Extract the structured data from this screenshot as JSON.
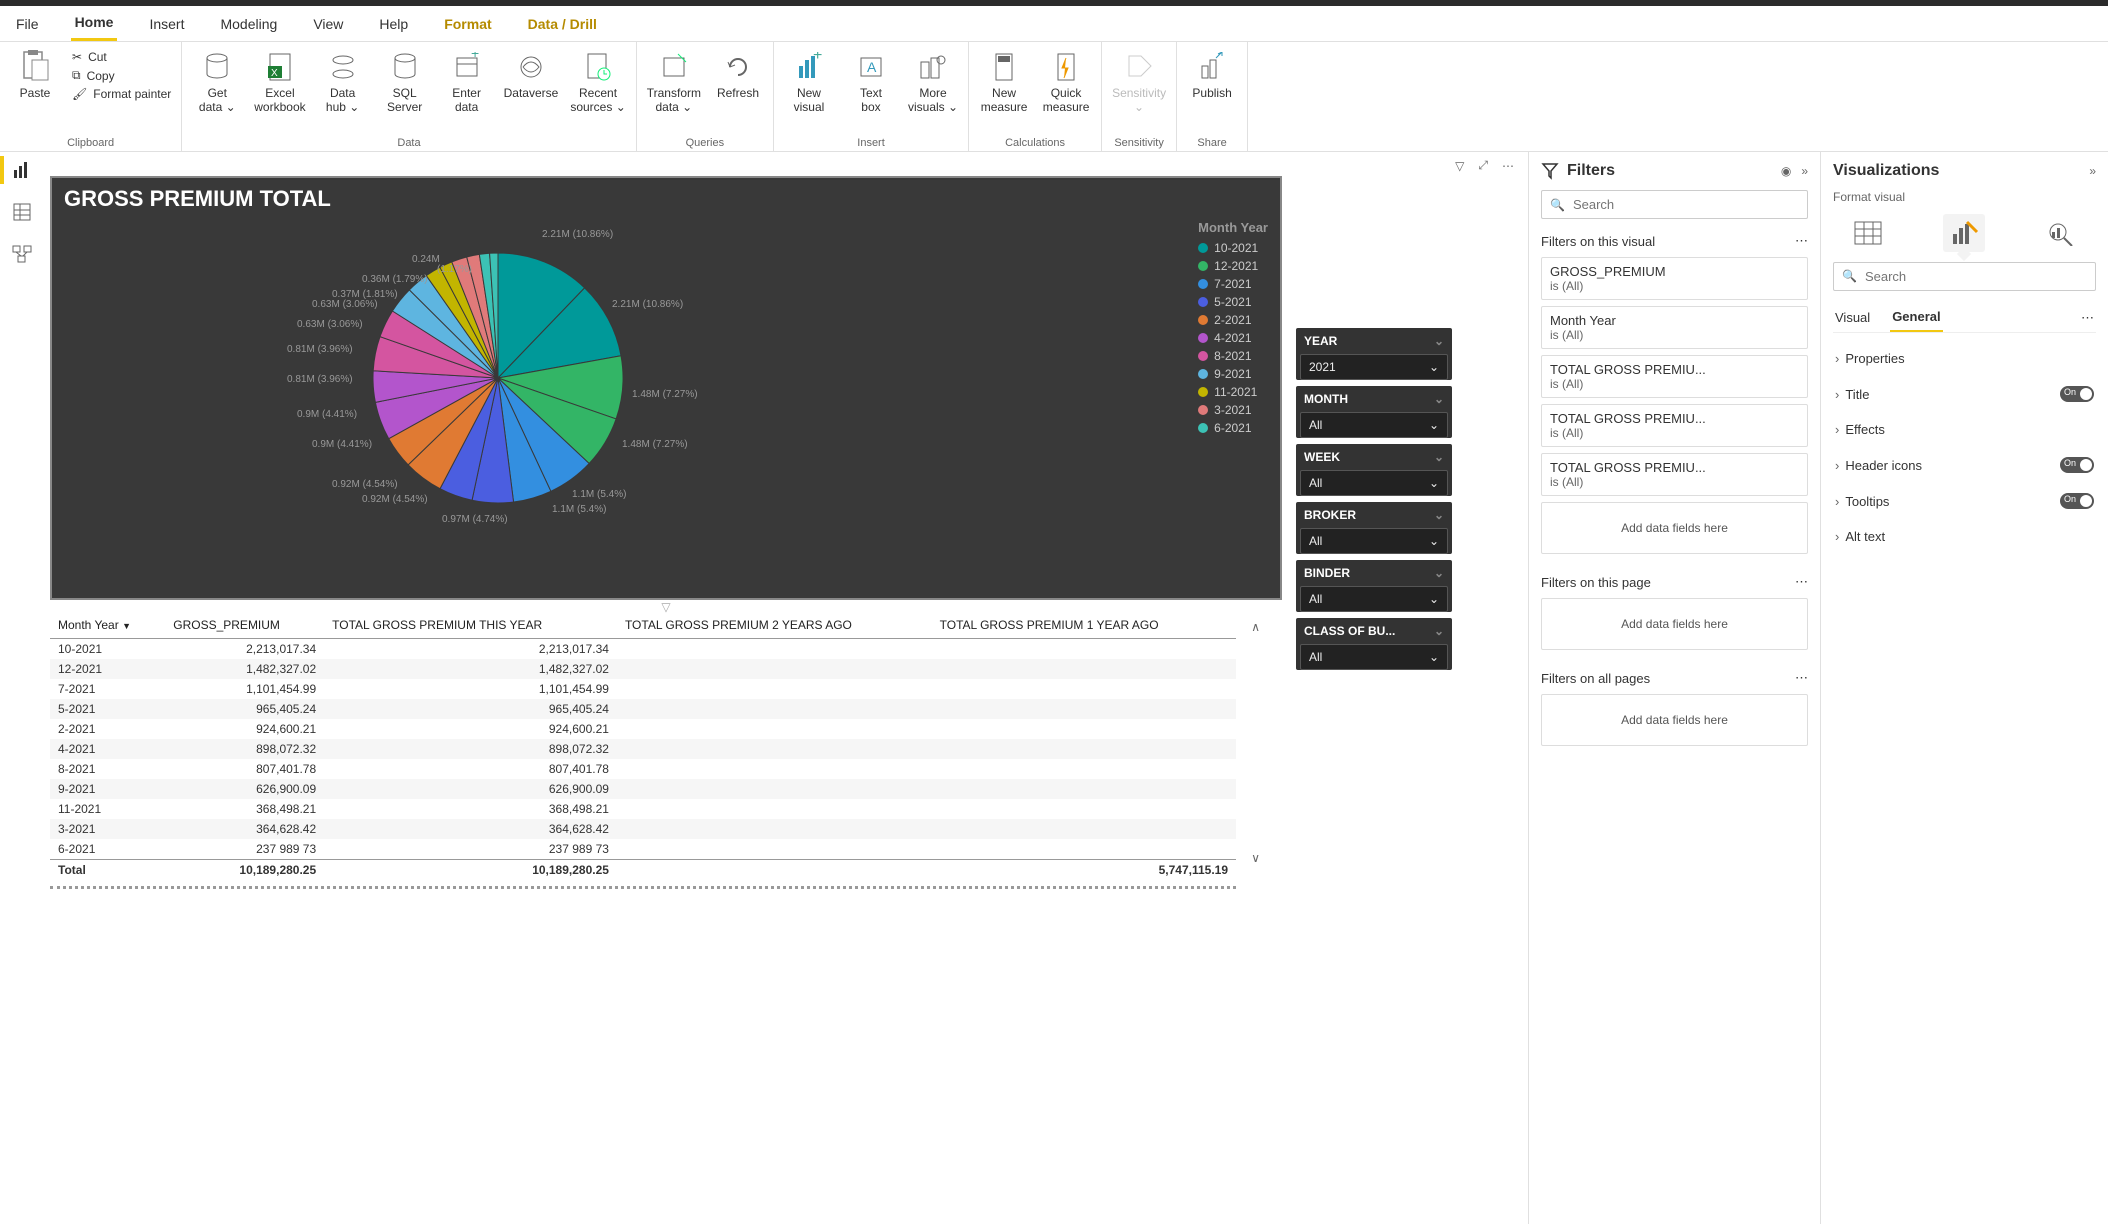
{
  "menu": [
    "File",
    "Home",
    "Insert",
    "Modeling",
    "View",
    "Help",
    "Format",
    "Data / Drill"
  ],
  "menu_active": "Home",
  "menu_highlight": [
    "Format",
    "Data / Drill"
  ],
  "ribbon": {
    "clipboard": {
      "paste": "Paste",
      "cut": "Cut",
      "copy": "Copy",
      "format_painter": "Format painter",
      "label": "Clipboard"
    },
    "data": {
      "get": "Get",
      "get2": "data",
      "excel": "Excel",
      "excel2": "workbook",
      "hub": "Data",
      "hub2": "hub",
      "sql": "SQL",
      "sql2": "Server",
      "enter": "Enter",
      "enter2": "data",
      "dv": "Dataverse",
      "recent": "Recent",
      "recent2": "sources",
      "label": "Data"
    },
    "queries": {
      "transform": "Transform",
      "transform2": "data",
      "refresh": "Refresh",
      "label": "Queries"
    },
    "insert": {
      "new": "New",
      "new2": "visual",
      "text": "Text",
      "text2": "box",
      "more": "More",
      "more2": "visuals",
      "label": "Insert"
    },
    "calc": {
      "newm": "New",
      "newm2": "measure",
      "quick": "Quick",
      "quick2": "measure",
      "label": "Calculations"
    },
    "sens": {
      "s": "Sensitivity",
      "label": "Sensitivity"
    },
    "share": {
      "p": "Publish",
      "label": "Share"
    }
  },
  "chart_title": "GROSS PREMIUM TOTAL",
  "legend_title": "Month Year",
  "chart_data": {
    "type": "pie",
    "title": "GROSS PREMIUM TOTAL",
    "series": [
      {
        "name": "10-2021",
        "value": 2213017.34,
        "label": "2.21M (10.86%)",
        "color": "#009999"
      },
      {
        "name": "12-2021",
        "value": 1482327.02,
        "label": "1.48M (7.27%)",
        "color": "#33b566"
      },
      {
        "name": "7-2021",
        "value": 1101454.99,
        "label": "1.1M (5.4%)",
        "color": "#338fe0"
      },
      {
        "name": "5-2021",
        "value": 965405.24,
        "label": "",
        "color": "#4b5ee0"
      },
      {
        "name": "2-2021",
        "value": 924600.21,
        "label": "",
        "color": "#e07a33"
      },
      {
        "name": "4-2021",
        "value": 898072.32,
        "label": "",
        "color": "#b355cc"
      },
      {
        "name": "8-2021",
        "value": 807401.78,
        "label": "",
        "color": "#d455a0"
      },
      {
        "name": "9-2021",
        "value": 626900.09,
        "label": "",
        "color": "#5eb5e0"
      },
      {
        "name": "11-2021",
        "value": 368498.21,
        "label": "",
        "color": "#c2b500"
      },
      {
        "name": "3-2021",
        "value": 364628.42,
        "label": "",
        "color": "#e07a7a"
      },
      {
        "name": "6-2021",
        "value": 237989.73,
        "label": "",
        "color": "#3cc2b5"
      }
    ],
    "chord_labels": [
      "2.21M (10.86%)",
      "2.21M (10.86%)",
      "1.48M (7.27%)",
      "1.48M (7.27%)",
      "1.1M (5.4%)",
      "1.1M (5.4%)",
      "0.97M (4.74%)",
      "0.92M (4.54%)",
      "0.92M (4.54%)",
      "0.9M (4.41%)",
      "0.9M (4.41%)",
      "0.81M (3.96%)",
      "0.81M (3.96%)",
      "0.63M (3.06%)",
      "0.63M (3.06%)",
      "0.37M (1.81%)",
      "0.36M (1.79%)",
      "0.24M",
      "(1.17%)"
    ]
  },
  "slicers": [
    {
      "title": "YEAR",
      "value": "2021"
    },
    {
      "title": "MONTH",
      "value": "All"
    },
    {
      "title": "WEEK",
      "value": "All"
    },
    {
      "title": "BROKER",
      "value": "All"
    },
    {
      "title": "BINDER",
      "value": "All"
    },
    {
      "title": "CLASS OF BU...",
      "value": "All"
    }
  ],
  "table": {
    "cols": [
      "Month Year",
      "GROSS_PREMIUM",
      "TOTAL GROSS PREMIUM THIS YEAR",
      "TOTAL GROSS PREMIUM 2 YEARS AGO",
      "TOTAL GROSS PREMIUM 1 YEAR AGO"
    ],
    "rows": [
      [
        "10-2021",
        "2,213,017.34",
        "2,213,017.34",
        "",
        ""
      ],
      [
        "12-2021",
        "1,482,327.02",
        "1,482,327.02",
        "",
        ""
      ],
      [
        "7-2021",
        "1,101,454.99",
        "1,101,454.99",
        "",
        ""
      ],
      [
        "5-2021",
        "965,405.24",
        "965,405.24",
        "",
        ""
      ],
      [
        "2-2021",
        "924,600.21",
        "924,600.21",
        "",
        ""
      ],
      [
        "4-2021",
        "898,072.32",
        "898,072.32",
        "",
        ""
      ],
      [
        "8-2021",
        "807,401.78",
        "807,401.78",
        "",
        ""
      ],
      [
        "9-2021",
        "626,900.09",
        "626,900.09",
        "",
        ""
      ],
      [
        "11-2021",
        "368,498.21",
        "368,498.21",
        "",
        ""
      ],
      [
        "3-2021",
        "364,628.42",
        "364,628.42",
        "",
        ""
      ],
      [
        "6-2021",
        "237 989 73",
        "237 989 73",
        "",
        ""
      ]
    ],
    "total": [
      "Total",
      "10,189,280.25",
      "10,189,280.25",
      "",
      "5,747,115.19"
    ]
  },
  "filters": {
    "title": "Filters",
    "search_placeholder": "Search",
    "visual_title": "Filters on this visual",
    "cards": [
      {
        "name": "GROSS_PREMIUM",
        "val": "is (All)"
      },
      {
        "name": "Month Year",
        "val": "is (All)"
      },
      {
        "name": "TOTAL GROSS PREMIU...",
        "val": "is (All)"
      },
      {
        "name": "TOTAL GROSS PREMIU...",
        "val": "is (All)"
      },
      {
        "name": "TOTAL GROSS PREMIU...",
        "val": "is (All)"
      }
    ],
    "add": "Add data fields here",
    "page_title": "Filters on this page",
    "all_title": "Filters on all pages"
  },
  "viz": {
    "title": "Visualizations",
    "sub": "Format visual",
    "search_placeholder": "Search",
    "tabs": [
      "Visual",
      "General"
    ],
    "rows": [
      {
        "name": "Properties",
        "toggle": false
      },
      {
        "name": "Title",
        "toggle": true
      },
      {
        "name": "Effects",
        "toggle": false
      },
      {
        "name": "Header icons",
        "toggle": true
      },
      {
        "name": "Tooltips",
        "toggle": true
      },
      {
        "name": "Alt text",
        "toggle": false
      }
    ],
    "toggle_on": "On"
  }
}
